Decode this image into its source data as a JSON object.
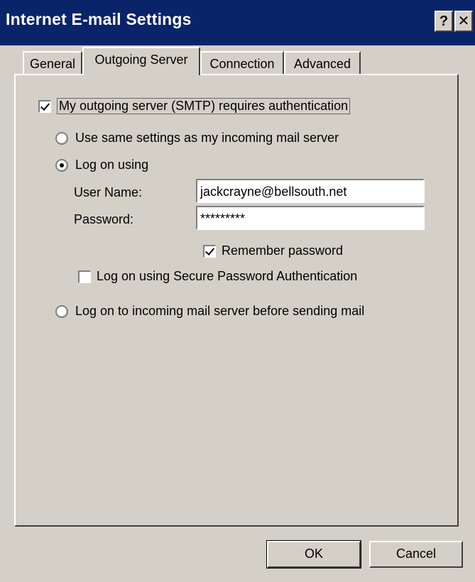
{
  "window": {
    "title": "Internet E-mail Settings",
    "help_glyph": "?",
    "close_glyph": "✕"
  },
  "tabs": [
    {
      "label": "General",
      "active": false
    },
    {
      "label": "Outgoing Server",
      "active": true
    },
    {
      "label": "Connection",
      "active": false
    },
    {
      "label": "Advanced",
      "active": false
    }
  ],
  "auth": {
    "requires_auth_label": "My outgoing server (SMTP) requires authentication",
    "requires_auth_checked": true,
    "same_settings_label": "Use same settings as my incoming mail server",
    "logon_using_label": "Log on using",
    "logon_mode": "logon_using",
    "username_label": "User Name:",
    "username_value": "jackcrayne@bellsouth.net",
    "password_label": "Password:",
    "password_value": "*********",
    "remember_label": "Remember password",
    "remember_checked": true,
    "spa_label": "Log on using Secure Password Authentication",
    "spa_checked": false,
    "incoming_first_label": "Log on to incoming mail server before sending mail"
  },
  "buttons": {
    "ok": "OK",
    "cancel": "Cancel"
  }
}
